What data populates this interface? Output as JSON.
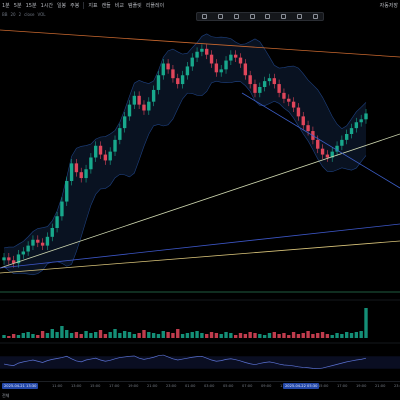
{
  "toolbar": {
    "items": [
      "1분",
      "5분",
      "15분",
      "1시간",
      "일봉",
      "주봉",
      "지표",
      "캔들",
      "비교",
      "템플릿"
    ],
    "replay": "리플레이",
    "right_label": "자동저장"
  },
  "legend": {
    "items": [
      "BB",
      "20",
      "2",
      "close",
      "VOL"
    ]
  },
  "x_axis": {
    "labels": [
      "11:00",
      "13:00",
      "15:00",
      "17:00",
      "19:00",
      "21:00",
      "23:00",
      "01:00",
      "03:00",
      "05:00",
      "07:00",
      "09:00",
      "11:00",
      "13:00",
      "15:00",
      "17:00",
      "19:00",
      "21:00",
      "23:00"
    ],
    "left_highlight": "2025-04-21 13:30",
    "right_highlight": "2025-04-22 05:30"
  },
  "bottom": {
    "label": "전체"
  },
  "colors": {
    "up": "#18a88c",
    "down": "#e0465b",
    "bb_line": "#2f66c9",
    "trend_orange": "#c9682f",
    "trend_white": "#cfd8b0",
    "trend_blue_steep": "#3c5fc9",
    "trend_blue_low": "#3d57c8",
    "trend_yellow": "#d9c47a",
    "trend_green": "#2c7a54",
    "rsi_line": "#5b72d4"
  },
  "chart_data": {
    "type": "candlestick",
    "close_series": [
      26,
      25,
      24,
      27,
      28,
      30,
      32,
      31,
      30,
      33,
      36,
      40,
      45,
      52,
      58,
      55,
      53,
      56,
      60,
      64,
      61,
      59,
      62,
      66,
      70,
      74,
      78,
      81,
      78,
      76,
      79,
      83,
      88,
      92,
      90,
      87,
      85,
      88,
      91,
      94,
      96,
      97,
      95,
      92,
      89,
      90,
      93,
      95,
      94,
      92,
      88,
      85,
      82,
      84,
      86,
      87,
      85,
      82,
      80,
      79,
      77,
      74,
      71,
      69,
      66,
      63,
      61,
      60,
      62,
      64,
      66,
      68,
      70,
      72,
      73,
      75
    ],
    "volume_series": [
      3,
      2,
      4,
      3,
      5,
      6,
      4,
      3,
      7,
      5,
      9,
      6,
      12,
      8,
      5,
      6,
      4,
      7,
      5,
      6,
      8,
      4,
      6,
      9,
      5,
      7,
      6,
      4,
      5,
      8,
      6,
      5,
      4,
      7,
      6,
      5,
      9,
      4,
      5,
      6,
      7,
      5,
      4,
      6,
      5,
      4,
      6,
      5,
      3,
      5,
      4,
      6,
      5,
      4,
      3,
      5,
      6,
      4,
      5,
      3,
      6,
      4,
      5,
      7,
      4,
      5,
      6,
      4,
      3,
      5,
      4,
      6,
      5,
      6,
      7,
      30
    ],
    "rsi_series": [
      45,
      42,
      40,
      48,
      52,
      55,
      58,
      54,
      50,
      56,
      60,
      63,
      66,
      70,
      62,
      55,
      52,
      58,
      61,
      64,
      58,
      54,
      57,
      62,
      66,
      68,
      70,
      71,
      64,
      60,
      63,
      67,
      72,
      74,
      68,
      62,
      58,
      61,
      64,
      67,
      69,
      70,
      64,
      58,
      54,
      56,
      60,
      62,
      59,
      55,
      50,
      46,
      43,
      47,
      50,
      52,
      49,
      45,
      42,
      41,
      39,
      36,
      34,
      33,
      31,
      30,
      32,
      36,
      40,
      44,
      48,
      52,
      55,
      58,
      60,
      64
    ]
  }
}
